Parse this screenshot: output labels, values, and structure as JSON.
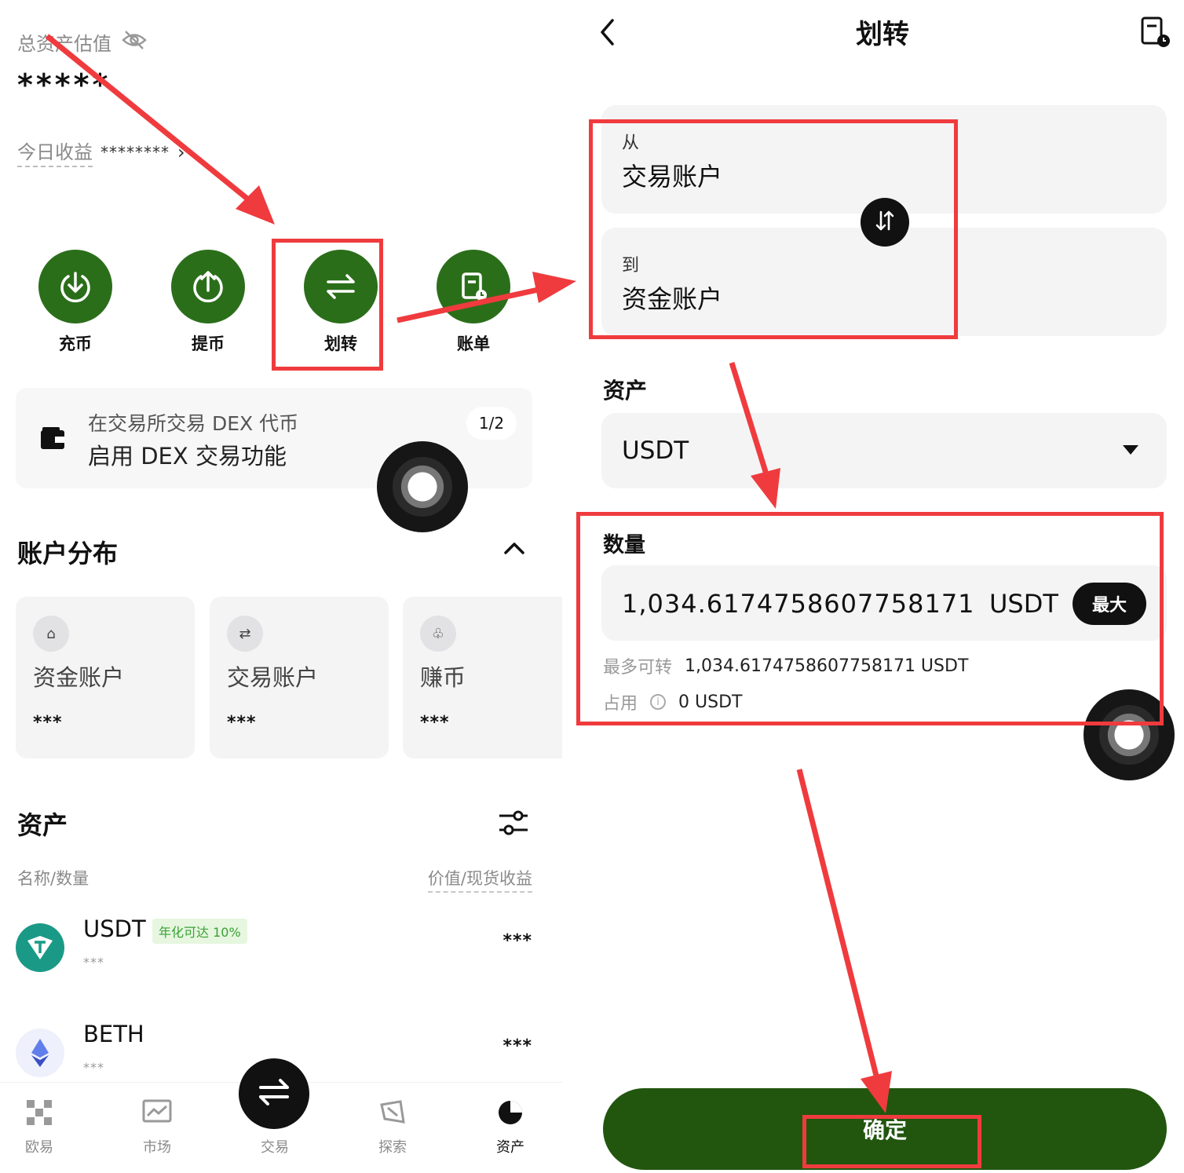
{
  "left": {
    "total_label": "总资产估值",
    "total_value": "*****",
    "today_label": "今日收益",
    "today_value": "******** ",
    "actions": [
      {
        "label": "充币",
        "icon": "deposit-icon"
      },
      {
        "label": "提币",
        "icon": "withdraw-icon"
      },
      {
        "label": "划转",
        "icon": "transfer-icon"
      },
      {
        "label": "账单",
        "icon": "bill-icon"
      }
    ],
    "promo": {
      "line1": "在交易所交易 DEX 代币",
      "line2": "启用 DEX 交易功能",
      "page": "1/2"
    },
    "accounts_title": "账户分布",
    "accounts": [
      {
        "name": "资金账户",
        "value": "***"
      },
      {
        "name": "交易账户",
        "value": "***"
      },
      {
        "name": "赚币",
        "value": "***"
      }
    ],
    "assets_title": "资产",
    "col_left": "名称/数量",
    "col_right": "价值/现货收益",
    "assets": [
      {
        "symbol": "USDT",
        "badge": "年化可达 10%",
        "amount": "***",
        "value": "***",
        "color": "#1a9a86"
      },
      {
        "symbol": "BETH",
        "badge": "",
        "amount": "***",
        "value": "***",
        "color": "#627eea"
      }
    ],
    "tabs": [
      "欧易",
      "市场",
      "交易",
      "探索",
      "资产"
    ]
  },
  "right": {
    "title": "划转",
    "from_label": "从",
    "from_value": "交易账户",
    "to_label": "到",
    "to_value": "资金账户",
    "asset_label": "资产",
    "asset_value": "USDT",
    "qty_label": "数量",
    "qty_value": "1,034.6174758607758171",
    "qty_unit": "USDT",
    "max_label": "最大",
    "max_transfer_label": "最多可转",
    "max_transfer_value": "1,034.6174758607758171 USDT",
    "occupied_label": "占用",
    "occupied_value": "0 USDT",
    "confirm_label": "确定"
  },
  "colors": {
    "brand_green": "#2b6e1a",
    "confirm_green": "#22560f",
    "annotation_red": "#ef3b3e"
  }
}
